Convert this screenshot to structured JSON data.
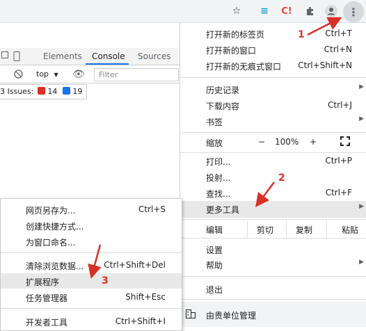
{
  "toolbar": {
    "icons": [
      "star-icon",
      "filter-extension-icon",
      "c-extension-icon",
      "puzzle-icon",
      "profile-icon",
      "kebab-menu-icon"
    ],
    "ext_letter": "C!"
  },
  "devtools": {
    "tabs": [
      "Elements",
      "Console",
      "Sources"
    ],
    "context": "top",
    "filter_placeholder": "Filter",
    "issues_label": "3 Issues:",
    "errors": "14",
    "infos": "19"
  },
  "main_menu": {
    "new_tab": {
      "label": "打开新的标签页",
      "shortcut": "Ctrl+T"
    },
    "new_window": {
      "label": "打开新的窗口",
      "shortcut": "Ctrl+N"
    },
    "incognito": {
      "label": "打开新的无痕式窗口",
      "shortcut": "Ctrl+Shift+N"
    },
    "history": {
      "label": "历史记录"
    },
    "downloads": {
      "label": "下载内容",
      "shortcut": "Ctrl+J"
    },
    "bookmarks": {
      "label": "书签"
    },
    "zoom": {
      "label": "缩放",
      "minus": "−",
      "value": "100%",
      "plus": "+"
    },
    "print": {
      "label": "打印...",
      "shortcut": "Ctrl+P"
    },
    "cast": {
      "label": "投射..."
    },
    "find": {
      "label": "查找...",
      "shortcut": "Ctrl+F"
    },
    "more_tools": {
      "label": "更多工具"
    },
    "edit": {
      "label": "编辑",
      "cut": "剪切",
      "copy": "复制",
      "paste": "粘贴"
    },
    "settings": {
      "label": "设置"
    },
    "help": {
      "label": "帮助"
    },
    "exit": {
      "label": "退出"
    },
    "managed": {
      "label": "由贵单位管理"
    }
  },
  "sub_menu": {
    "save_page": {
      "label": "网页另存为...",
      "shortcut": "Ctrl+S"
    },
    "create_shortcut": {
      "label": "创建快捷方式..."
    },
    "name_window": {
      "label": "为窗口命名..."
    },
    "clear_data": {
      "label": "清除浏览数据...",
      "shortcut": "Ctrl+Shift+Del"
    },
    "extensions": {
      "label": "扩展程序"
    },
    "task_manager": {
      "label": "任务管理器",
      "shortcut": "Shift+Esc"
    },
    "dev_tools": {
      "label": "开发者工具",
      "shortcut": "Ctrl+Shift+I"
    }
  },
  "annotations": {
    "step1": "1",
    "step2": "2",
    "step3": "3"
  },
  "colors": {
    "annotation": "#d93025",
    "accent": "#1a73e8"
  }
}
